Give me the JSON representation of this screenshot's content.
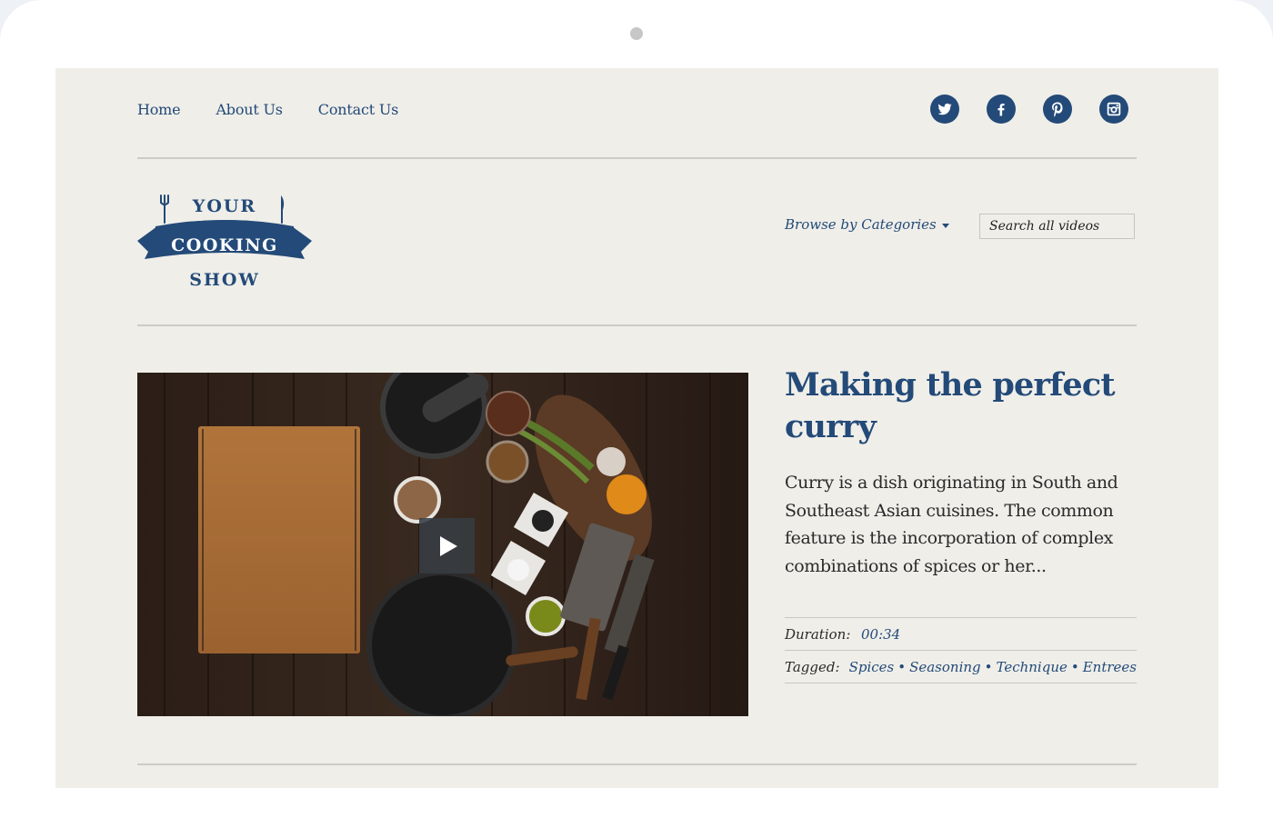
{
  "nav": {
    "items": [
      {
        "label": "Home"
      },
      {
        "label": "About Us"
      },
      {
        "label": "Contact Us"
      }
    ]
  },
  "social": [
    {
      "name": "twitter",
      "icon": "twitter-icon"
    },
    {
      "name": "facebook",
      "icon": "facebook-icon"
    },
    {
      "name": "pinterest",
      "icon": "pinterest-icon"
    },
    {
      "name": "instagram",
      "icon": "instagram-icon"
    }
  ],
  "logo": {
    "line1": "YOUR",
    "line2": "COOKING",
    "line3": "SHOW"
  },
  "browse": {
    "label": "Browse by Categories"
  },
  "search": {
    "placeholder": "Search all videos"
  },
  "featured": {
    "title": "Making the perfect curry",
    "description": "Curry is a dish originating in South and Southeast Asian cuisines. The common feature is the incorporation of complex combinations of spices or her...",
    "duration_label": "Duration:",
    "duration": "00:34",
    "tagged_label": "Tagged:",
    "tags": [
      "Spices",
      "Seasoning",
      "Technique",
      "Entrees"
    ],
    "tag_separator": "•",
    "play_icon": "play-icon"
  },
  "colors": {
    "brand": "#234a78",
    "background": "#efeee9",
    "divider": "#cdcbc6"
  }
}
